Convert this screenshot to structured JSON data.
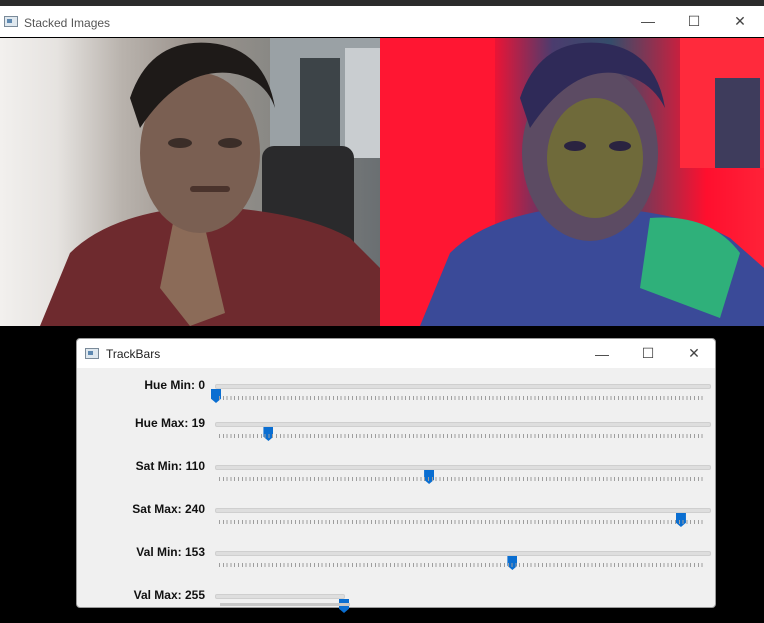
{
  "main_window": {
    "title": "Stacked Images",
    "controls": {
      "minimize": "—",
      "maximize": "☐",
      "close": "✕"
    }
  },
  "trackbars_window": {
    "title": "TrackBars",
    "controls": {
      "minimize": "—",
      "maximize": "☐",
      "close": "✕"
    },
    "sliders": [
      {
        "label": "Hue Min: 0",
        "value": 0,
        "max": 179
      },
      {
        "label": "Hue Max: 19",
        "value": 19,
        "max": 179
      },
      {
        "label": "Sat Min: 110",
        "value": 110,
        "max": 255
      },
      {
        "label": "Sat Max: 240",
        "value": 240,
        "max": 255
      },
      {
        "label": "Val Min: 153",
        "value": 153,
        "max": 255
      },
      {
        "label": "Val Max: 255",
        "value": 255,
        "max": 255
      }
    ]
  },
  "colors": {
    "accent": "#0a6ed1",
    "mask_red": "#ff0f2e"
  }
}
